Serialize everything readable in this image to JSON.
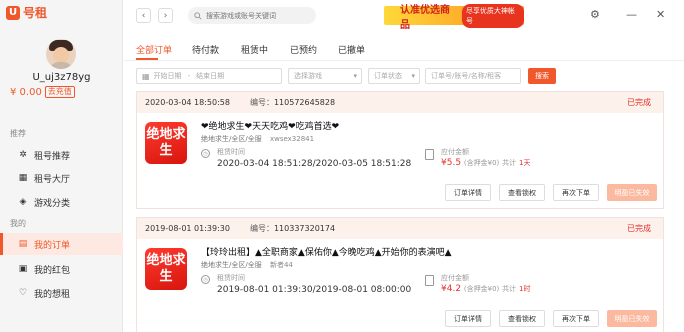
{
  "app": {
    "logo_mark": "U",
    "logo_text": "号租"
  },
  "user": {
    "username": "U_uj3z78yg",
    "balance": "¥ 0.00",
    "recharge_label": "去充值"
  },
  "sidebar": {
    "section_recommend": "推荐",
    "section_mine": "我的",
    "items": [
      {
        "label": "租号推荐",
        "icon": "gear-icon"
      },
      {
        "label": "租号大厅",
        "icon": "grid-icon"
      },
      {
        "label": "游戏分类",
        "icon": "gamepad-icon"
      },
      {
        "label": "我的订单",
        "icon": "order-icon",
        "active": true
      },
      {
        "label": "我的红包",
        "icon": "redpacket-icon"
      },
      {
        "label": "我的想租",
        "icon": "heart-icon"
      }
    ]
  },
  "topbar": {
    "back_label": "‹",
    "forward_label": "›",
    "search_placeholder": "搜索游戏或账号关键词",
    "banner_main": "认准优选商品",
    "banner_sub": "尽享优质大神帐号",
    "settings_icon": "gear-icon",
    "minimize_icon": "minimize-icon",
    "close_icon": "close-icon"
  },
  "tabs": [
    "全部订单",
    "待付款",
    "租赁中",
    "已预约",
    "已撤单"
  ],
  "filters": {
    "start_date": "开始日期",
    "separator": "-",
    "end_date": "结束日期",
    "game_select": "选择游戏",
    "status_select": "订单状态",
    "keyword_placeholder": "订单号/账号/名称/租客",
    "search_button": "搜索"
  },
  "orders": [
    {
      "date": "2020-03-04 18:50:58",
      "number_label": "编号：",
      "number": "110572645828",
      "status": "已完成",
      "game_tile": "绝地求生",
      "title": "❤绝地求生❤天天吃鸡❤吃鸡首选❤",
      "server": "绝地求生/全区/全服",
      "account": "xwsex32841",
      "rent_label": "租赁时间",
      "rent_time": "2020-03-04 18:51:28/2020-03-05 18:51:28",
      "pay_label": "应付金额",
      "amount": "¥5.5",
      "deposit": "(含押金¥0)",
      "count_label": "共计",
      "count": "1天",
      "buttons": [
        "订单详情",
        "查看锁权",
        "再次下单",
        "明盈已失效"
      ]
    },
    {
      "date": "2019-08-01 01:39:30",
      "number_label": "编号：",
      "number": "110337320174",
      "status": "已完成",
      "game_tile": "绝地求生",
      "title": "【玲玲出租】▲全职商家▲保佑你▲今晚吃鸡▲开始你的表演吧▲",
      "server": "绝地求生/全区/全服",
      "account": "新者44",
      "rent_label": "租赁时间",
      "rent_time": "2019-08-01 01:39:30/2019-08-01 08:00:00",
      "pay_label": "应付金额",
      "amount": "¥4.2",
      "deposit": "(含押金¥0)",
      "count_label": "共计",
      "count": "1时",
      "buttons": [
        "订单详情",
        "查看锁权",
        "再次下单",
        "明盈已失效"
      ]
    }
  ]
}
